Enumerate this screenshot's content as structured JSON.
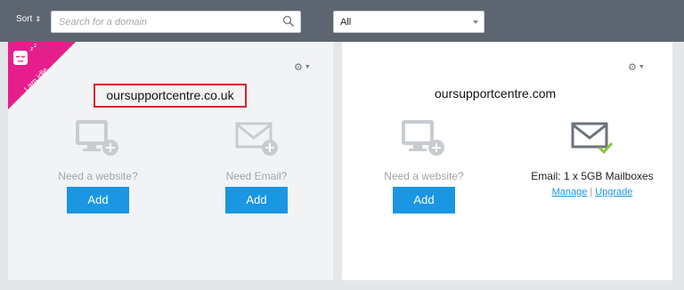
{
  "toolbar": {
    "sort_label": "Sort",
    "search_placeholder": "Search for a domain",
    "filter_value": "All"
  },
  "cards": [
    {
      "ribbon": "I am idle",
      "domain": "oursupportcentre.co.uk",
      "website": {
        "label": "Need a website?",
        "button": "Add"
      },
      "email": {
        "label": "Need Email?",
        "button": "Add"
      }
    },
    {
      "domain": "oursupportcentre.com",
      "website": {
        "label": "Need a website?",
        "button": "Add"
      },
      "email": {
        "label": "Email: 1 x 5GB Mailboxes",
        "manage": "Manage",
        "upgrade": "Upgrade"
      }
    }
  ],
  "colors": {
    "accent": "#1a96e3",
    "ribbon": "#e61e8c",
    "highlight": "#d9262e",
    "toolbar": "#5d6570",
    "check": "#8cc63f"
  }
}
